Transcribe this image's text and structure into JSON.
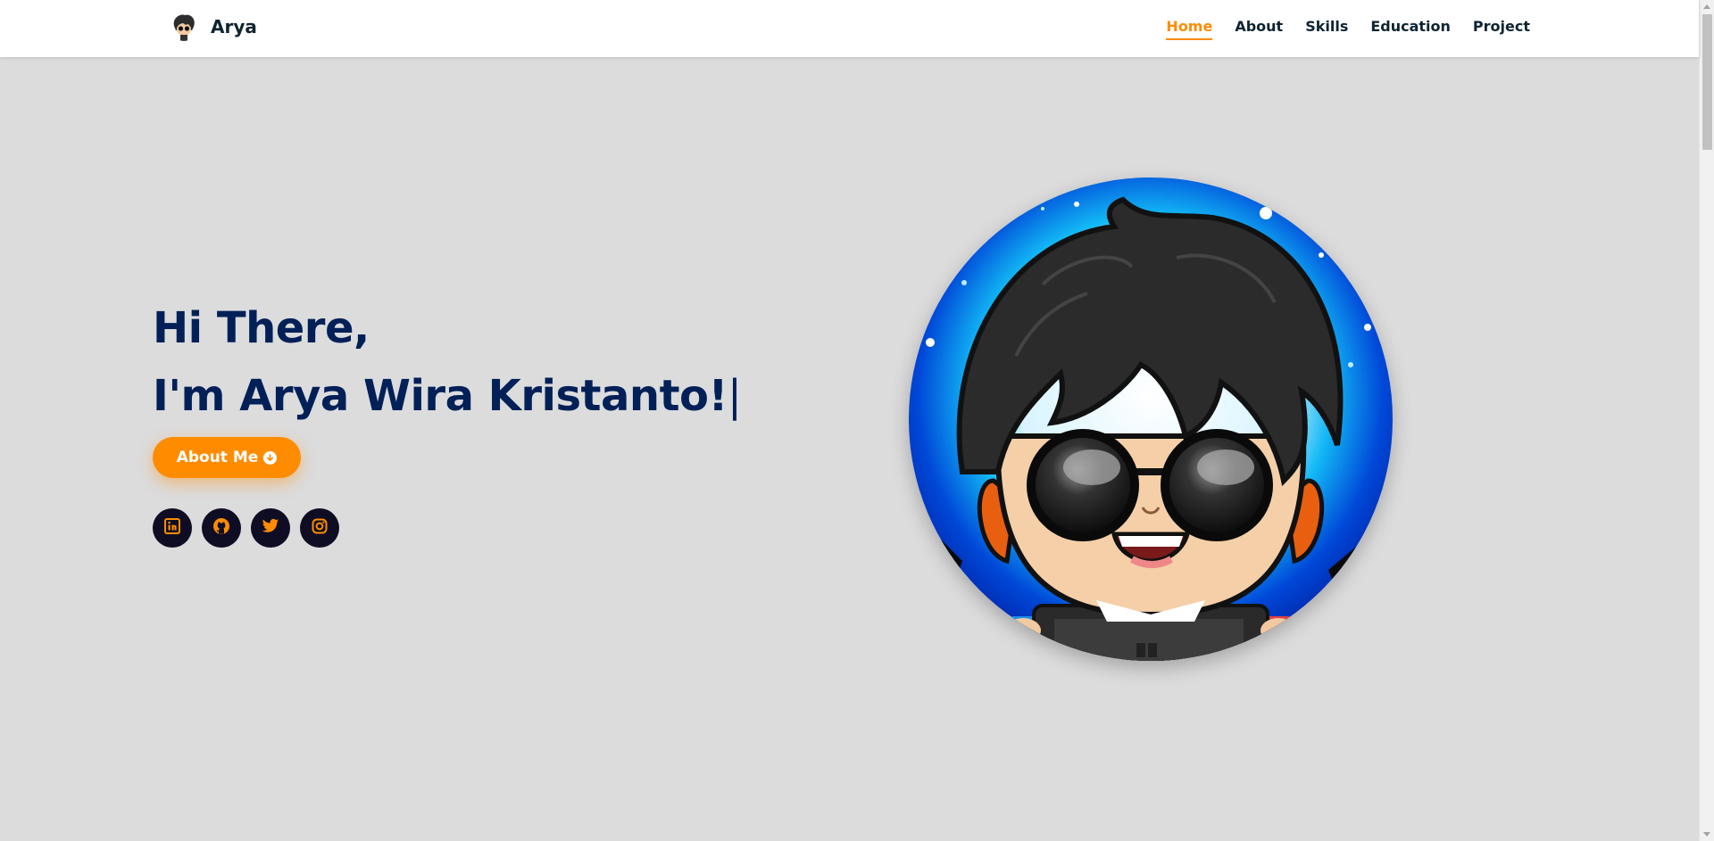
{
  "brand": {
    "name": "Arya",
    "logo": "avatar-logo-icon"
  },
  "nav": {
    "items": [
      {
        "label": "Home",
        "active": true
      },
      {
        "label": "About",
        "active": false
      },
      {
        "label": "Skills",
        "active": false
      },
      {
        "label": "Education",
        "active": false
      },
      {
        "label": "Project",
        "active": false
      }
    ]
  },
  "hero": {
    "greeting": "Hi There,",
    "intro": "I'm Arya Wira Kristanto!",
    "cursor": "|",
    "button_label": "About Me",
    "button_icon": "arrow-down-circle-icon"
  },
  "socials": [
    {
      "name": "linkedin",
      "icon": "linkedin-icon"
    },
    {
      "name": "github",
      "icon": "github-icon"
    },
    {
      "name": "twitter",
      "icon": "twitter-icon"
    },
    {
      "name": "instagram",
      "icon": "instagram-icon"
    }
  ],
  "colors": {
    "accent": "#fc8c05",
    "heading": "#002057",
    "background": "#dcdcdd",
    "social_bg": "#0e0d24"
  }
}
